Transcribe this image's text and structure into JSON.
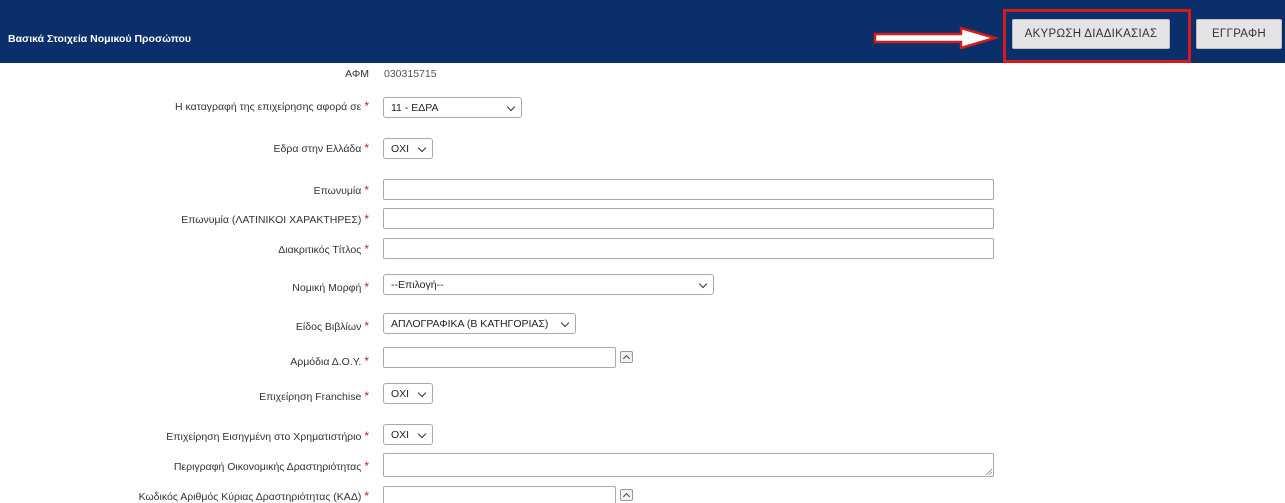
{
  "header": {
    "title": "Βασικά Στοιχεία Νομικού Προσώπου",
    "cancel_label": "ΑΚΥΡΩΣΗ ΔΙΑΔΙΚΑΣΙΑΣ",
    "register_label": "ΕΓΓΡΑΦΗ",
    "annotation_color": "#d61a1a",
    "bar_color": "#0a2f6b"
  },
  "form": {
    "afm_label": "ΑΦΜ",
    "afm_value": "030315715",
    "registration_concerns_label": "Η καταγραφή της επιχείρησης αφορά σε",
    "registration_concerns_value": "11 - ΕΔΡΑ",
    "seat_in_greece_label": "Εδρα στην Ελλάδα",
    "seat_in_greece_value": "ΟΧΙ",
    "name_label": "Επωνυμία",
    "name_value": "",
    "name_latin_label": "Επωνυμία (ΛΑΤΙΝΙΚΟΙ ΧΑΡΑΚΤΗΡΕΣ)",
    "name_latin_value": "",
    "distinctive_title_label": "Διακριτικός Τίτλος",
    "distinctive_title_value": "",
    "legal_form_label": "Νομική Μορφή",
    "legal_form_value": "--Επιλογή--",
    "books_type_label": "Είδος Βιβλίων",
    "books_type_value": "ΑΠΛΟΓΡΑΦΙΚΑ (Β ΚΑΤΗΓΟΡΙΑΣ)",
    "tax_office_label": "Αρμόδια Δ.Ο.Υ.",
    "tax_office_value": "",
    "franchise_label": "Επιχείρηση Franchise",
    "franchise_value": "ΟΧΙ",
    "listed_label": "Επιχείρηση Εισηγμένη στο Χρηματιστήριο",
    "listed_value": "ΟΧΙ",
    "activity_description_label": "Περιγραφή Οικονομικής Δραστηριότητας",
    "activity_description_value": "",
    "kad_label": "Κωδικός Αριθμός Κύριας Δραστηριότητας (ΚΑΔ)",
    "kad_value": "",
    "required_mark": "*"
  }
}
